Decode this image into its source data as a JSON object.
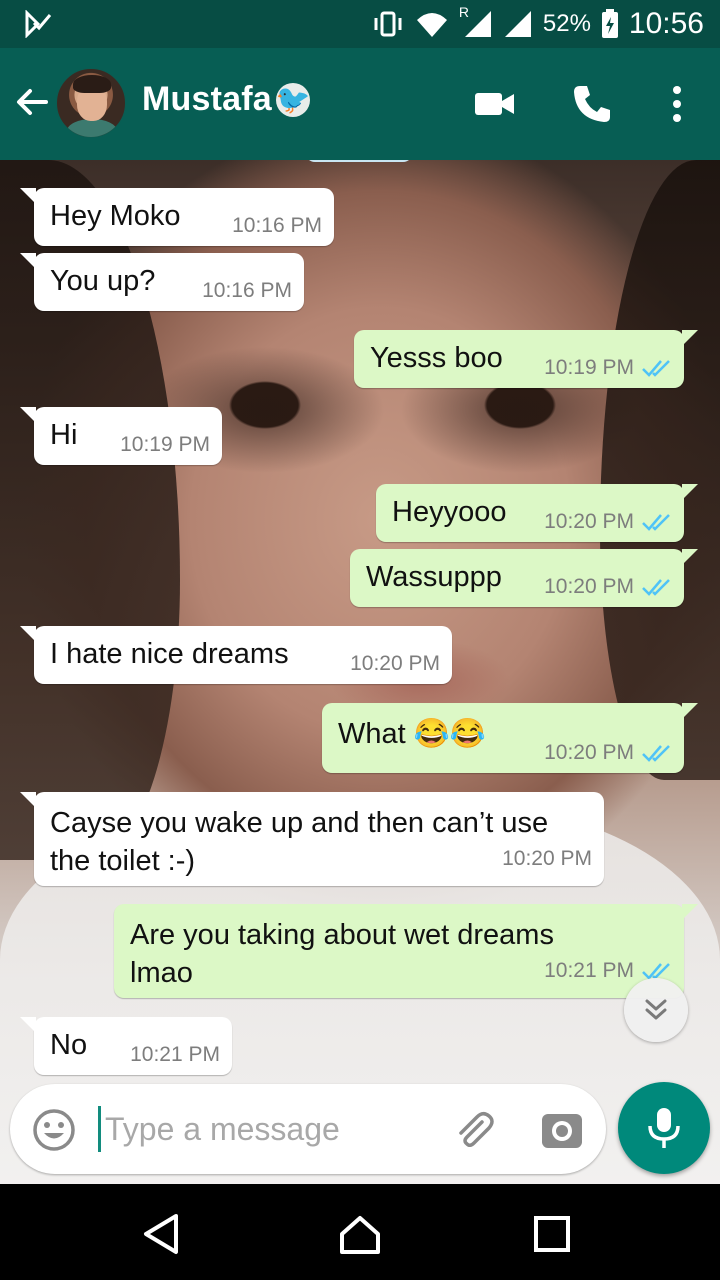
{
  "status_bar": {
    "battery": "52%",
    "time": "10:56",
    "roaming_indicator": "R"
  },
  "header": {
    "contact_name": "Mustafa",
    "contact_emoji": "🐦"
  },
  "messages": [
    {
      "dir": "in",
      "text": "Hey Moko",
      "time": "10:16 PM"
    },
    {
      "dir": "in",
      "text": "You up?",
      "time": "10:16 PM"
    },
    {
      "dir": "out",
      "text": "Yesss boo",
      "time": "10:19 PM"
    },
    {
      "dir": "in",
      "text": "Hi",
      "time": "10:19 PM"
    },
    {
      "dir": "out",
      "text": "Heyyooo",
      "time": "10:20 PM"
    },
    {
      "dir": "out",
      "text": "Wassuppp",
      "time": "10:20 PM"
    },
    {
      "dir": "in",
      "text": "I hate nice dreams",
      "time": "10:20 PM"
    },
    {
      "dir": "out",
      "text": "What 😂😂",
      "time": "10:20 PM"
    },
    {
      "dir": "in",
      "text": "Cayse you wake up and then can’t use the toilet :-)",
      "time": "10:20 PM"
    },
    {
      "dir": "out",
      "text": "Are you taking about wet dreams lmao",
      "time": "10:21 PM"
    },
    {
      "dir": "in",
      "text": "No",
      "time": "10:21 PM"
    }
  ],
  "composer": {
    "placeholder": "Type a message",
    "value": ""
  },
  "colors": {
    "header_bg": "#075e54",
    "status_bg": "#074d44",
    "outgoing_bubble": "#dcf8c6",
    "incoming_bubble": "#ffffff",
    "read_ticks": "#4fc3f7",
    "fab": "#00897b"
  },
  "icons": {
    "status_left": "notification-icon",
    "vibrate": "vibrate-icon",
    "wifi": "wifi-icon",
    "signal": "signal-icon",
    "battery": "battery-charging-icon",
    "back": "arrow-left-icon",
    "video": "video-call-icon",
    "phone": "voice-call-icon",
    "menu": "more-vert-icon",
    "emoji": "emoji-icon",
    "attach": "paperclip-icon",
    "camera": "camera-icon",
    "mic": "mic-icon",
    "scroll_down": "double-chevron-down-icon",
    "nav_back": "nav-back-icon",
    "nav_home": "nav-home-icon",
    "nav_recents": "nav-recents-icon"
  }
}
